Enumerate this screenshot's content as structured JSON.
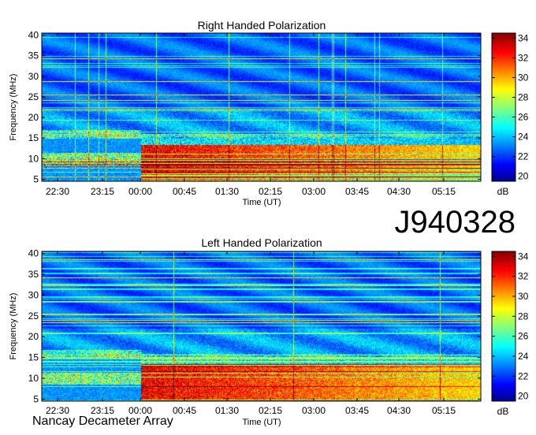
{
  "figure": {
    "observation_id": "J940328",
    "instrument": "Nancay Decameter Array"
  },
  "chart_data": [
    {
      "type": "heatmap",
      "title": "Right Handed Polarization",
      "xlabel": "Time (UT)",
      "ylabel": "Frequency (MHz)",
      "x_tick_labels": [
        "22:30",
        "23:15",
        "00:00",
        "00:45",
        "01:30",
        "02:15",
        "03:00",
        "03:45",
        "04:30",
        "05:15"
      ],
      "y_ticks": [
        5,
        10,
        15,
        20,
        25,
        30,
        35,
        40
      ],
      "ylim": [
        4.5,
        40.5
      ],
      "colorbar": {
        "label": "dB",
        "ticks": [
          20,
          22,
          24,
          26,
          28,
          30,
          32,
          34
        ],
        "range": [
          19.5,
          34.5
        ]
      },
      "colormap": "jet",
      "emission_summary": [
        {
          "time_range": [
            "00:00",
            "05:50"
          ],
          "freq_range_mhz": [
            6,
            13
          ],
          "level_db": 33
        },
        {
          "time_range": [
            "22:30",
            "00:00"
          ],
          "freq_range_mhz": [
            9,
            11
          ],
          "level_db": 31
        }
      ]
    },
    {
      "type": "heatmap",
      "title": "Left Handed Polarization",
      "xlabel": "Time (UT)",
      "ylabel": "Frequency (MHz)",
      "x_tick_labels": [
        "22:30",
        "23:15",
        "00:00",
        "00:45",
        "01:30",
        "02:15",
        "03:00",
        "03:45",
        "04:30",
        "05:15"
      ],
      "y_ticks": [
        5,
        10,
        15,
        20,
        25,
        30,
        35,
        40
      ],
      "ylim": [
        4.5,
        40.5
      ],
      "colorbar": {
        "label": "dB",
        "ticks": [
          20,
          22,
          24,
          26,
          28,
          30,
          32,
          34
        ],
        "range": [
          19.5,
          34.5
        ]
      },
      "colormap": "jet",
      "emission_summary": [
        {
          "time_range": [
            "00:00",
            "05:50"
          ],
          "freq_range_mhz": [
            6,
            13
          ],
          "level_db": 33
        },
        {
          "time_range": [
            "22:30",
            "00:00"
          ],
          "freq_range_mhz": [
            9,
            11
          ],
          "level_db": 31
        }
      ]
    }
  ]
}
